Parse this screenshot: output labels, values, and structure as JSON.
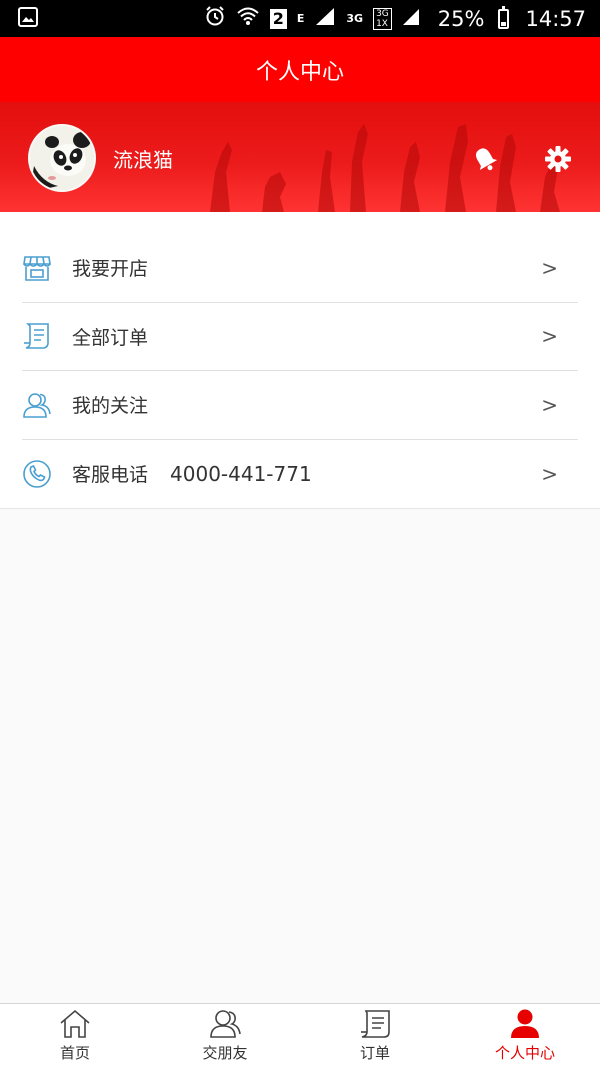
{
  "status_bar": {
    "sim_label": "2",
    "network_e": "E",
    "network_3g": "3G",
    "network_3g2": "3G",
    "network_1x": "1X",
    "battery": "25%",
    "time": "14:57"
  },
  "header": {
    "title": "个人中心"
  },
  "profile": {
    "username": "流浪猫"
  },
  "menu": {
    "items": [
      {
        "label": "我要开店",
        "extra": "",
        "arrow": ">",
        "icon": "store-icon"
      },
      {
        "label": "全部订单",
        "extra": "",
        "arrow": ">",
        "icon": "order-icon"
      },
      {
        "label": "我的关注",
        "extra": "",
        "arrow": ">",
        "icon": "friends-icon"
      },
      {
        "label": "客服电话",
        "extra": "4000-441-771",
        "arrow": ">",
        "icon": "phone-icon"
      }
    ]
  },
  "bottom_nav": {
    "items": [
      {
        "label": "首页",
        "icon": "home-icon"
      },
      {
        "label": "交朋友",
        "icon": "friends-icon"
      },
      {
        "label": "订单",
        "icon": "order-icon"
      },
      {
        "label": "个人中心",
        "icon": "person-icon",
        "active": true
      }
    ]
  },
  "colors": {
    "brand": "#ff0000",
    "accent_icon": "#4a9fd0",
    "active_nav": "#e60000"
  }
}
